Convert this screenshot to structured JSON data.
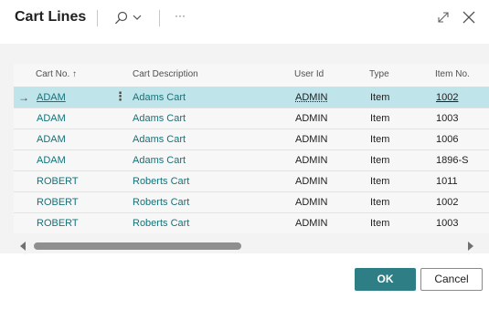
{
  "dialog": {
    "title": "Cart Lines",
    "search_icon": "search-icon",
    "more_label": "···",
    "expand_icon": "expand-icon",
    "close_icon": "close-icon"
  },
  "table": {
    "columns": [
      "Cart No. ↑",
      "Cart Description",
      "User Id",
      "Type",
      "Item No."
    ],
    "rows": [
      {
        "cart_no": "ADAM",
        "description": "Adams Cart",
        "user_id": "ADMIN",
        "type": "Item",
        "item_no": "1002"
      },
      {
        "cart_no": "ADAM",
        "description": "Adams Cart",
        "user_id": "ADMIN",
        "type": "Item",
        "item_no": "1003"
      },
      {
        "cart_no": "ADAM",
        "description": "Adams Cart",
        "user_id": "ADMIN",
        "type": "Item",
        "item_no": "1006"
      },
      {
        "cart_no": "ADAM",
        "description": "Adams Cart",
        "user_id": "ADMIN",
        "type": "Item",
        "item_no": "1896-S"
      },
      {
        "cart_no": "ROBERT",
        "description": "Roberts Cart",
        "user_id": "ADMIN",
        "type": "Item",
        "item_no": "1011"
      },
      {
        "cart_no": "ROBERT",
        "description": "Roberts Cart",
        "user_id": "ADMIN",
        "type": "Item",
        "item_no": "1002"
      },
      {
        "cart_no": "ROBERT",
        "description": "Roberts Cart",
        "user_id": "ADMIN",
        "type": "Item",
        "item_no": "1003"
      }
    ],
    "selected_row": 0,
    "row_indicator": "→",
    "row_menu": "⋮"
  },
  "footer": {
    "ok_label": "OK",
    "cancel_label": "Cancel"
  },
  "colors": {
    "accent": "#2d7f85",
    "link": "#13737a",
    "selected_row": "#bfe5ea"
  }
}
